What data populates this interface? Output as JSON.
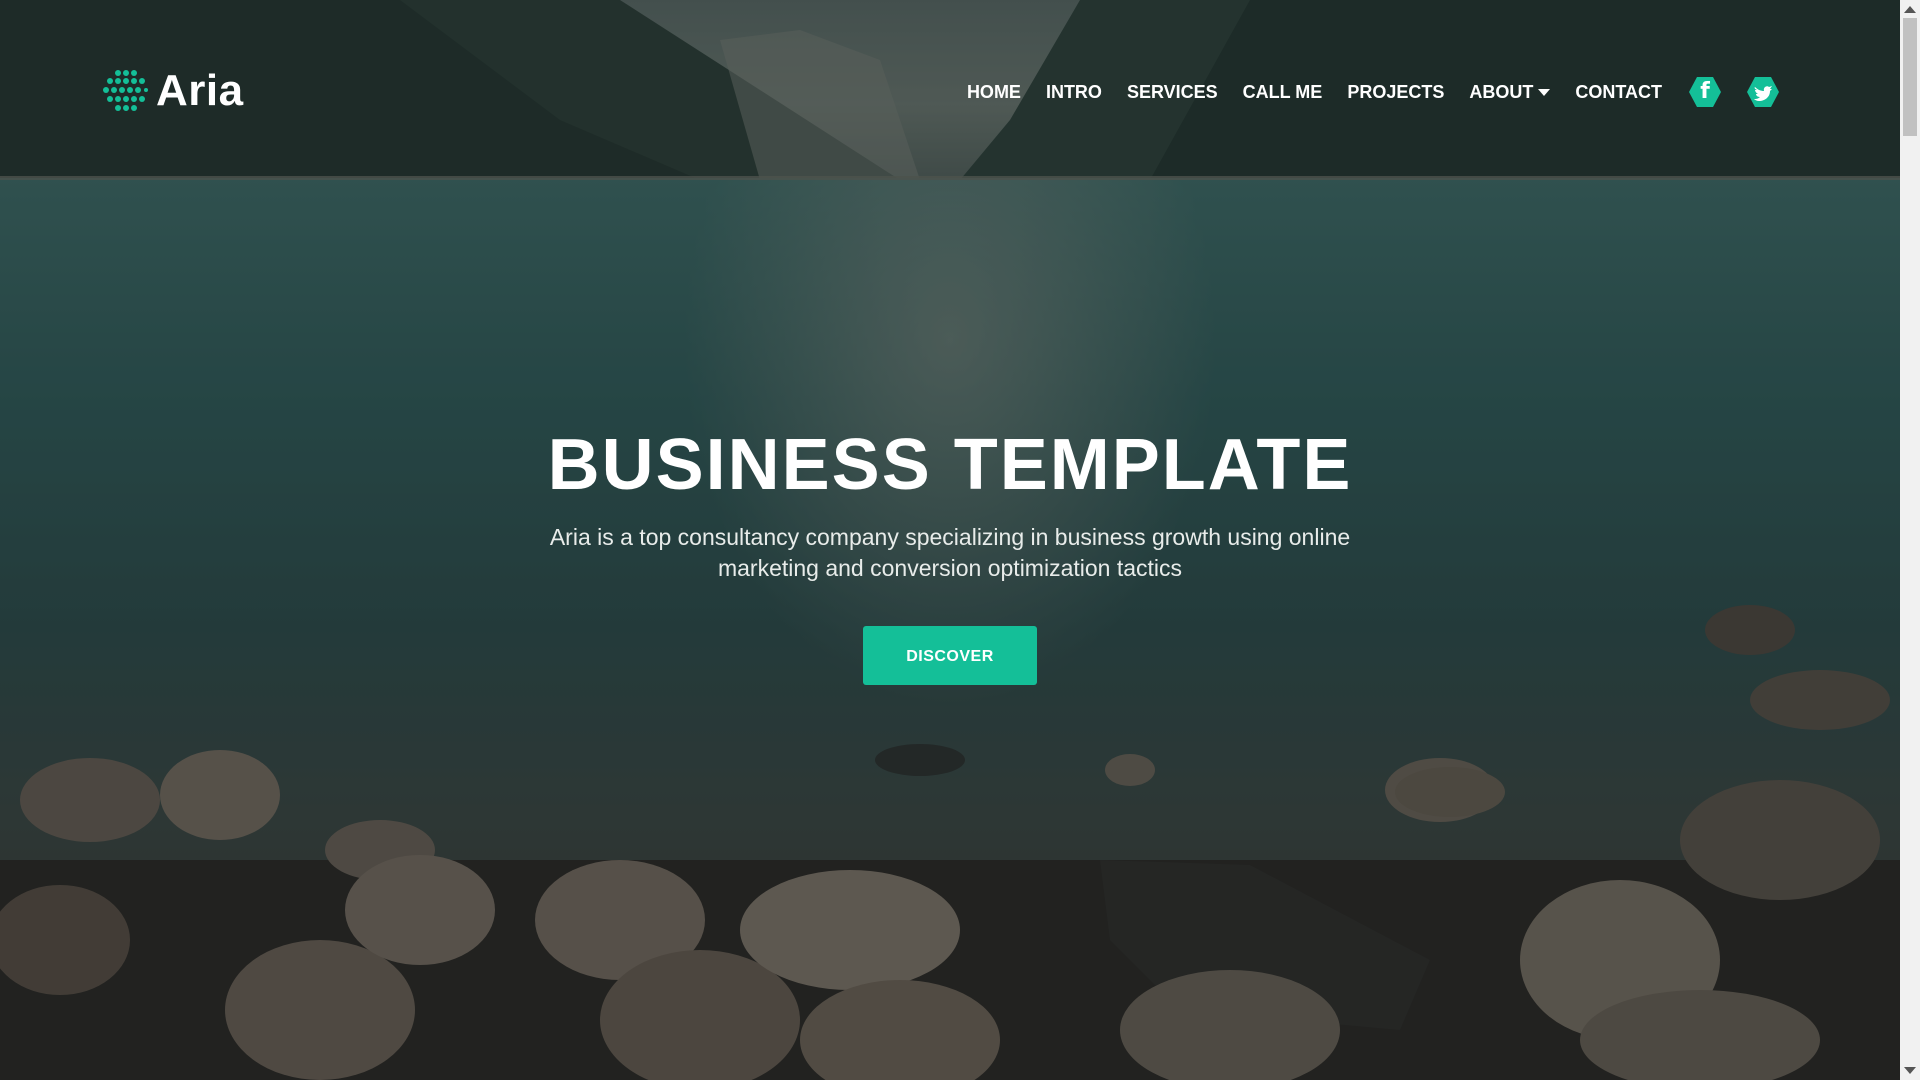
{
  "brand": {
    "name": "Aria",
    "accent_color": "#14bf98"
  },
  "nav": {
    "items": [
      {
        "label": "HOME"
      },
      {
        "label": "INTRO"
      },
      {
        "label": "SERVICES"
      },
      {
        "label": "CALL ME"
      },
      {
        "label": "PROJECTS"
      },
      {
        "label": "ABOUT",
        "has_dropdown": true
      },
      {
        "label": "CONTACT"
      }
    ],
    "social": [
      {
        "icon": "facebook-icon",
        "glyph": "f"
      },
      {
        "icon": "twitter-icon",
        "glyph": "🐦"
      }
    ]
  },
  "hero": {
    "title": "BUSINESS TEMPLATE",
    "subtitle": "Aria is a top consultancy company specializing in business growth using online marketing and conversion optimization tactics",
    "cta_label": "DISCOVER"
  },
  "background": {
    "scene": "lake-mountains-rocks"
  }
}
